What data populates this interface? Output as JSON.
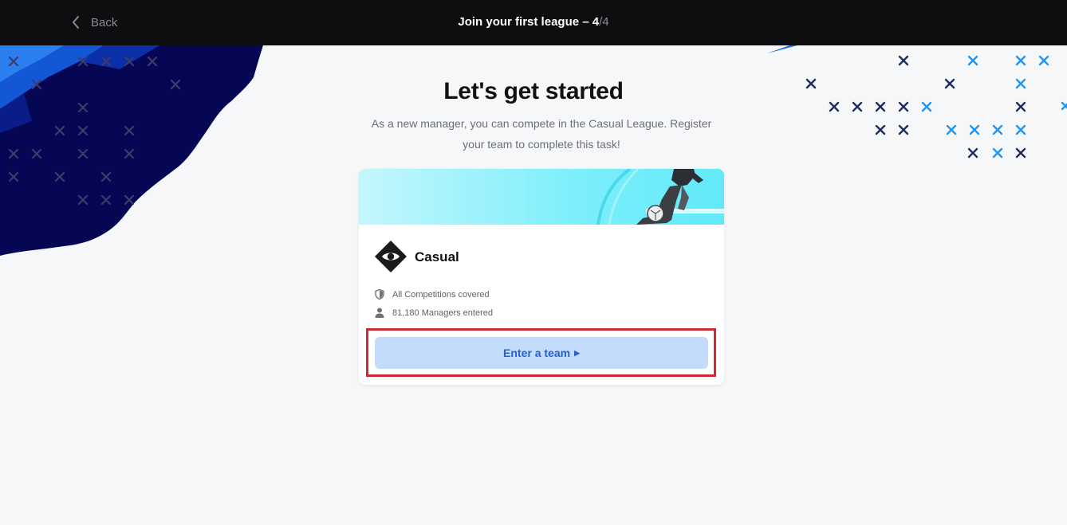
{
  "header": {
    "back_label": "Back",
    "title_prefix": "Join your first league – ",
    "step_current": "4",
    "step_total": "/4"
  },
  "main": {
    "headline": "Let's get started",
    "subtitle": "As a new manager, you can compete in the Casual League. Register your team to complete this task!"
  },
  "league_card": {
    "name": "Casual",
    "competitions_text": "All Competitions covered",
    "managers_text": "81,180 Managers entered",
    "enter_button_label": "Enter a team"
  },
  "colors": {
    "topbar": "#0e0e10",
    "button_bg": "#c3dcfb",
    "button_text": "#2660c9",
    "highlight": "#cc2a35",
    "banner_cyan": "#62e9f8"
  }
}
